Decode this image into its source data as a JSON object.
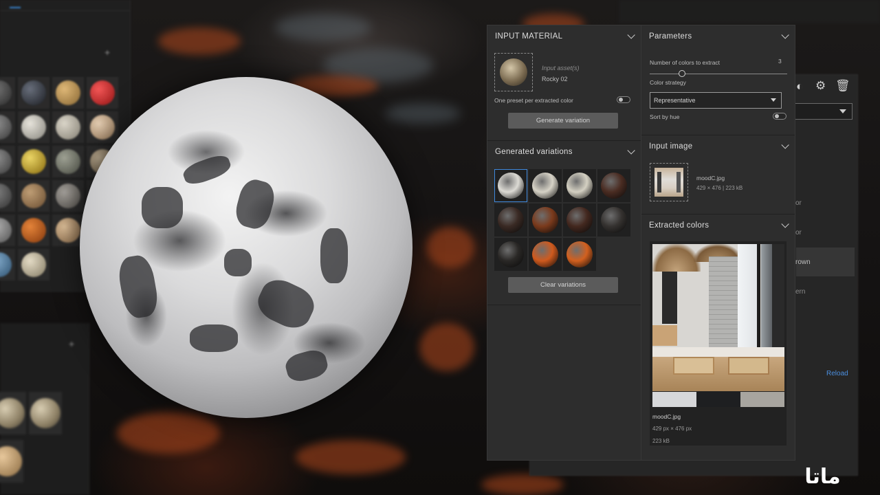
{
  "input_material": {
    "title": "INPUT MATERIAL",
    "asset_caption": "Input asset(s)",
    "asset_name": "Rocky  02",
    "one_preset_label": "One preset per extracted color",
    "one_preset_enabled": false,
    "generate_button": "Generate variation"
  },
  "generated_variations": {
    "title": "Generated variations",
    "clear_button": "Clear variations",
    "items": [
      {
        "color": "#dcdad4",
        "selected": true
      },
      {
        "color": "#d6d2c6",
        "selected": false
      },
      {
        "color": "#d4d0c2",
        "selected": false
      },
      {
        "color": "#4a2c22",
        "selected": false
      },
      {
        "color": "#3a2a24",
        "selected": false
      },
      {
        "color": "#7a3a1c",
        "selected": false
      },
      {
        "color": "#43281f",
        "selected": false
      },
      {
        "color": "#353230",
        "selected": false
      },
      {
        "color": "#2a2826",
        "selected": false
      },
      {
        "color": "#cf5a1e",
        "selected": false
      },
      {
        "color": "#d2601f",
        "selected": false
      }
    ]
  },
  "parameters": {
    "title": "Parameters",
    "num_colors_label": "Number of colors to extract",
    "num_colors_value": "3",
    "color_strategy_label": "Color strategy",
    "color_strategy_value": "Representative",
    "sort_by_hue_label": "Sort by hue",
    "sort_by_hue_enabled": false
  },
  "input_image": {
    "title": "Input image",
    "file_name": "moodC.jpg",
    "file_info": "429 × 476 | 223 kB"
  },
  "extracted_colors": {
    "title": "Extracted colors",
    "file_name": "moodC.jpg",
    "dimensions": "429 px × 476 px",
    "size": "223 kB",
    "colors": [
      "#d6d7d9",
      "#1e1f21",
      "#a8a59f"
    ]
  },
  "background_panel": {
    "fragments": [
      "or",
      "or",
      "rown",
      "ern"
    ],
    "reload": "Reload"
  },
  "watermark": "ماتا"
}
